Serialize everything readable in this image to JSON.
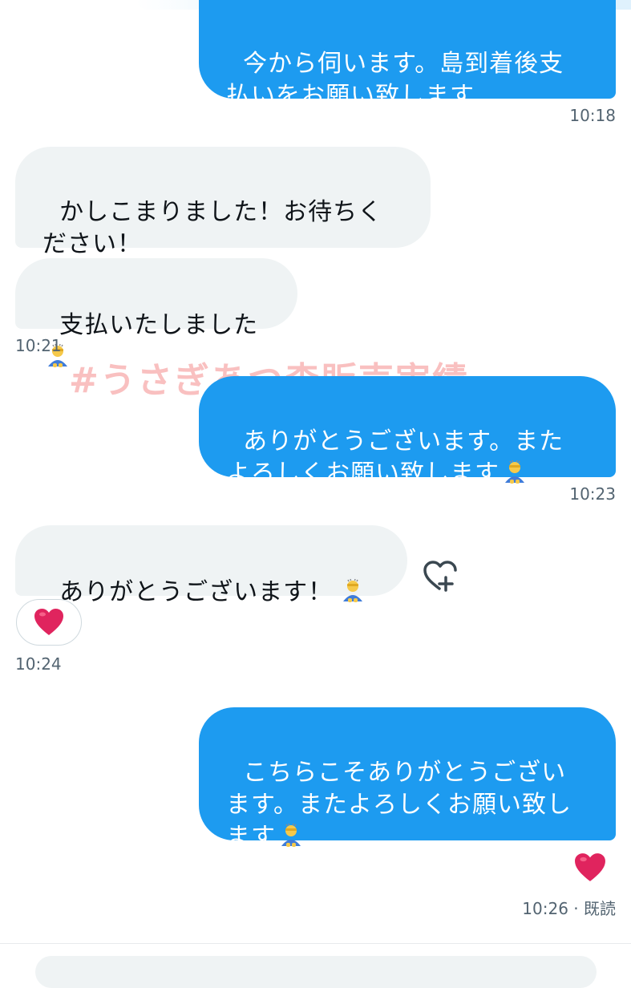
{
  "messages": [
    {
      "text": "今から伺います。島到着後支払いをお願い致します"
    },
    {
      "text": "かしこまりました！お待ちください！"
    },
    {
      "text": "支払いたしました"
    },
    {
      "text": "ありがとうございます。またよろしくお願い致します"
    },
    {
      "text": "ありがとうございます！"
    },
    {
      "text": "こちらこそありがとうございます。またよろしくお願い致します"
    }
  ],
  "timestamps": {
    "t1": "10:18",
    "t2": "10:21",
    "t3": "10:23",
    "t4": "10:24",
    "t5": "10:26 · 既読"
  },
  "watermark": "#うさぎあつ森販売実績",
  "reactions": {
    "received_heart": "❤️",
    "sent_heart": "❤️"
  },
  "icons": {
    "bow_emoji": "person-bowing-icon",
    "add_reaction": "heart-plus-icon",
    "heart": "red-heart-icon"
  },
  "colors": {
    "outgoing_bubble": "#1d9bf0",
    "incoming_bubble": "#eff3f4",
    "timestamp": "#536471",
    "heart": "#e0245e"
  }
}
